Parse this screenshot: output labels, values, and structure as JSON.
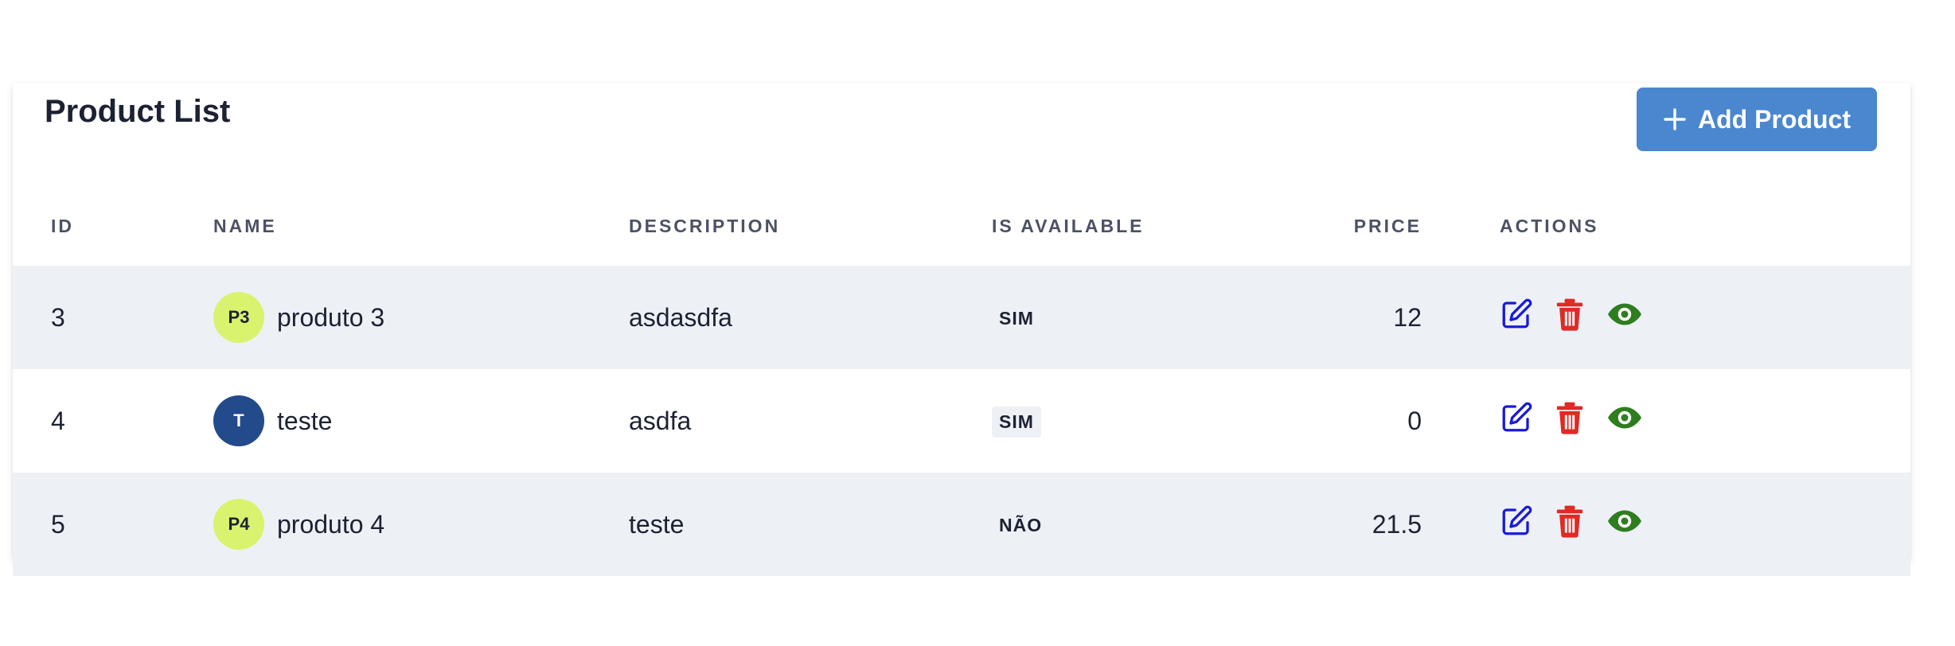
{
  "page": {
    "title": "Product List",
    "add_button_label": "Add Product"
  },
  "colors": {
    "accent": "#4a87cf",
    "edit": "#1a1ad6",
    "delete": "#e02a24",
    "view": "#2e7d1e",
    "avatar_light": "#d9f36e",
    "avatar_dark": "#234a8a"
  },
  "table": {
    "headers": [
      "ID",
      "NAME",
      "DESCRIPTION",
      "IS AVAILABLE",
      "PRICE",
      "ACTIONS"
    ],
    "rows": [
      {
        "id": "3",
        "avatar": "P3",
        "name": "produto 3",
        "description": "asdasdfa",
        "available": "SIM",
        "price": "12"
      },
      {
        "id": "4",
        "avatar": "T",
        "name": "teste",
        "description": "asdfa",
        "available": "SIM",
        "price": "0"
      },
      {
        "id": "5",
        "avatar": "P4",
        "name": "produto 4",
        "description": "teste",
        "available": "NÃO",
        "price": "21.5"
      }
    ],
    "action_icons": [
      "edit-icon",
      "trash-icon",
      "eye-icon"
    ]
  }
}
